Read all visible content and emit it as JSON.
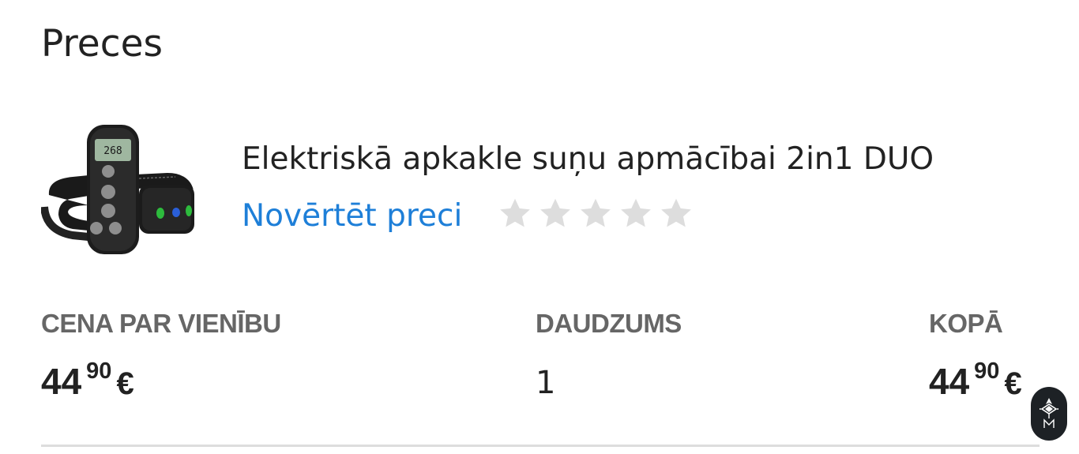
{
  "section": {
    "title": "Preces"
  },
  "product": {
    "name": "Elektriskā apkakle suņu apmācībai 2in1 DUO",
    "image_alt": "Elektriskā apkakle suņu apmācībai 2in1 DUO",
    "rate_link": "Novērtēt preci",
    "rating": 0,
    "rating_max": 5,
    "remote_display": "268"
  },
  "columns": {
    "unit_price_label": "CENA PAR VIENĪBU",
    "quantity_label": "DAUDZUMS",
    "total_label": "KOPĀ"
  },
  "unit_price": {
    "int": "44",
    "cents": "90",
    "currency": "€"
  },
  "quantity": "1",
  "total": {
    "int": "44",
    "cents": "90",
    "currency": "€"
  },
  "colors": {
    "link": "#1e7fd8",
    "star_empty": "#dddddd",
    "label": "#666666",
    "text": "#222222"
  },
  "icons": {
    "stars": "star-icon",
    "fab": "widget-logo-icon"
  }
}
